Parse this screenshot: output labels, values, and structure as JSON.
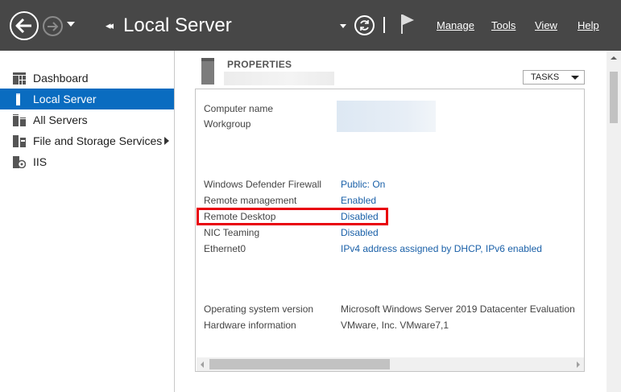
{
  "header": {
    "title": "Local Server",
    "menu": [
      {
        "id": "manage",
        "label": "Manage"
      },
      {
        "id": "tools",
        "label": "Tools"
      },
      {
        "id": "view",
        "label": "View"
      },
      {
        "id": "help",
        "label": "Help"
      }
    ],
    "icons": [
      "back-arrow-icon",
      "forward-arrow-icon",
      "refresh-icon",
      "flag-icon"
    ]
  },
  "sidebar": {
    "items": [
      {
        "label": "Dashboard",
        "icon": "dashboard-icon"
      },
      {
        "label": "Local Server",
        "icon": "local-server-icon",
        "active": true
      },
      {
        "label": "All Servers",
        "icon": "all-servers-icon"
      },
      {
        "label": "File and Storage Services",
        "icon": "file-storage-icon",
        "has_submenu": true
      },
      {
        "label": "IIS",
        "icon": "iis-icon"
      }
    ]
  },
  "properties": {
    "title": "PROPERTIES",
    "tasks_label": "TASKS",
    "groups": [
      {
        "rows": [
          {
            "key": "Computer name",
            "value": ""
          },
          {
            "key": "Workgroup",
            "value": ""
          }
        ]
      },
      {
        "rows": [
          {
            "key": "Windows Defender Firewall",
            "value": "Public: On"
          },
          {
            "key": "Remote management",
            "value": "Enabled"
          },
          {
            "key": "Remote Desktop",
            "value": "Disabled"
          },
          {
            "key": "NIC Teaming",
            "value": "Disabled"
          },
          {
            "key": "Ethernet0",
            "value": "IPv4 address assigned by DHCP, IPv6 enabled"
          }
        ]
      },
      {
        "rows": [
          {
            "key": "Operating system version",
            "value": "Microsoft Windows Server 2019 Datacenter Evaluation"
          },
          {
            "key": "Hardware information",
            "value": "VMware, Inc. VMware7,1"
          }
        ]
      }
    ]
  },
  "colors": {
    "header_bg": "#474747",
    "active_item": "#0a6cc0",
    "link": "#1a60a8",
    "highlight": "#e8000b"
  }
}
